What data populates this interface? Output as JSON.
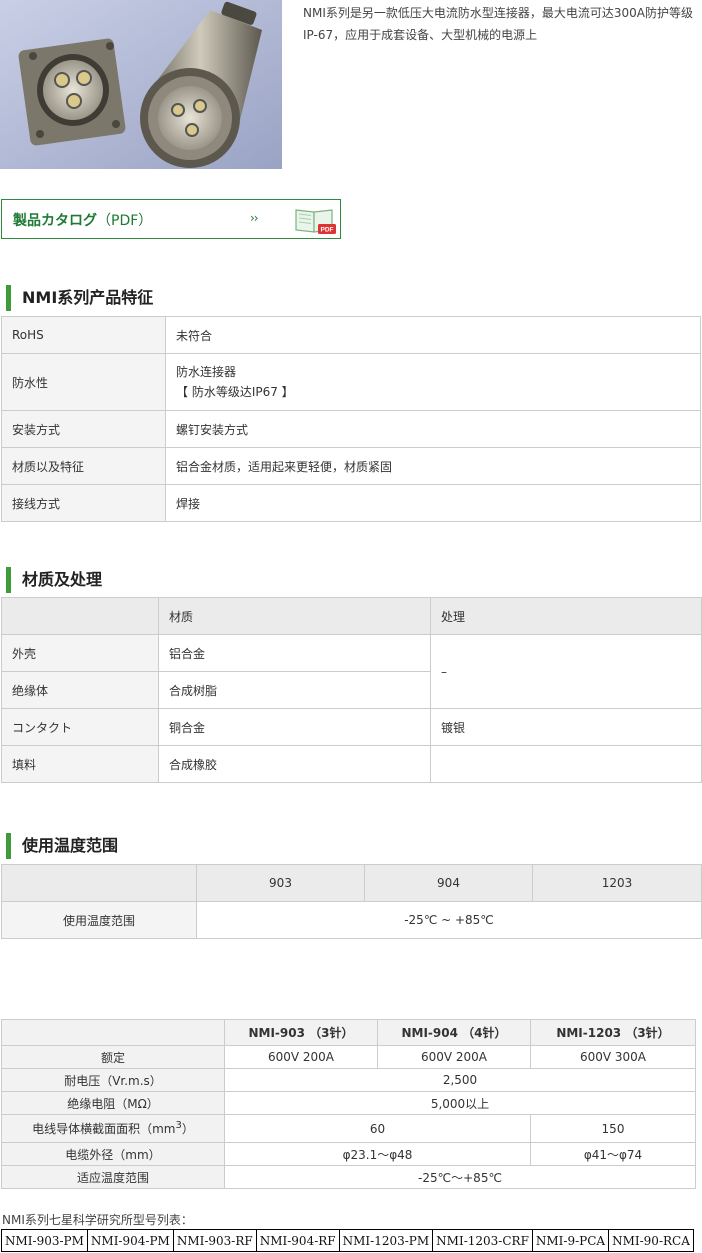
{
  "intro_text": "NMI系列是另一款低压大电流防水型连接器，最大电流可达300A防护等级IP-67，应用于成套设备、大型机械的电源上",
  "catalog": {
    "label": "製品カタログ",
    "suffix": "（PDF）",
    "arrow": "››",
    "icon": "pdf-book-icon",
    "icon_badge": "PDF"
  },
  "sections": {
    "features": "NMI系列产品特征",
    "material": "材质及处理",
    "temperature": "使用温度范围"
  },
  "features": [
    {
      "key": "RoHS",
      "value": "未符合"
    },
    {
      "key": "防水性",
      "value": "防水连接器",
      "value2": "【 防水等级达IP67 】"
    },
    {
      "key": "安装方式",
      "value": "螺钉安装方式"
    },
    {
      "key": "材质以及特征",
      "value": "铝合金材质，适用起来更轻便，材质紧固"
    },
    {
      "key": "接线方式",
      "value": "焊接"
    }
  ],
  "material": {
    "headers": [
      "",
      "材质",
      "处理"
    ],
    "rows": [
      {
        "part": "外壳",
        "material": "铝合金"
      },
      {
        "part": "绝缘体",
        "material": "合成树脂"
      },
      {
        "part": "コンタクト",
        "material": "铜合金",
        "treatment": "镀银"
      },
      {
        "part": "填料",
        "material": "合成橡胶",
        "treatment": ""
      }
    ],
    "merged_treatment": "–"
  },
  "temperature": {
    "headers": [
      "",
      "903",
      "904",
      "1203"
    ],
    "row_label": "使用温度范围",
    "value": "-25℃ ~ +85℃"
  },
  "specs": {
    "headers": [
      "",
      "NMI-903 （3针）",
      "NMI-904 （4针）",
      "NMI-1203 （3针）"
    ],
    "rated": {
      "label": "额定",
      "v903": "600V 200A",
      "v904": "600V 200A",
      "v1203": "600V 300A"
    },
    "withstand": {
      "label": "耐电压（Vr.m.s）",
      "value": "2,500"
    },
    "insulation": {
      "label": "绝缘电阻（MΩ）",
      "value": "5,000以上"
    },
    "wire_area": {
      "label": "电线导体横截面面积（mm",
      "sup": "3",
      "label_end": "）",
      "v_small": "60",
      "v1203": "150"
    },
    "cable_od": {
      "label": "电缆外径（mm）",
      "v_small": "φ23.1～φ48",
      "v1203": "φ41～φ74"
    },
    "temp": {
      "label": "适应温度范围",
      "value": "-25℃～+85℃"
    }
  },
  "models_label": "NMI系列七星科学研究所型号列表：",
  "models": [
    "NMI-903-PM",
    "NMI-904-PM",
    "NMI-903-RF",
    "NMI-904-RF",
    "NMI-1203-PM",
    "NMI-1203-CRF",
    "NMI-9-PCA",
    "NMI-90-RCA"
  ]
}
